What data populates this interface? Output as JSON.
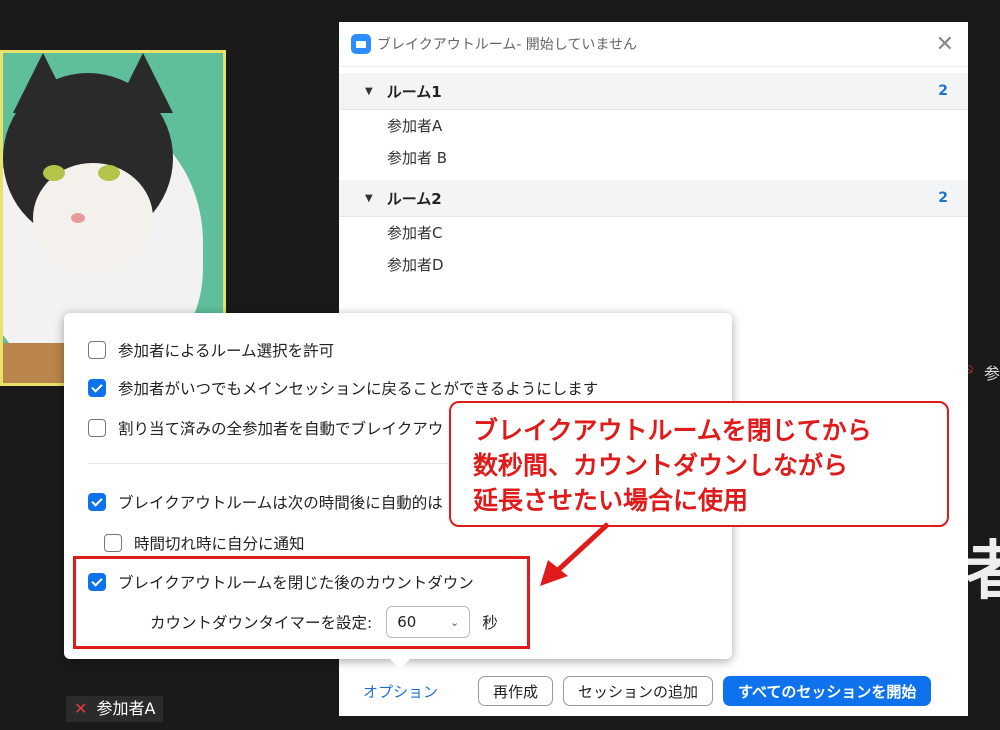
{
  "background": {
    "right_tile_label": "参",
    "right_big_text": "者",
    "bottom_participant_name": "参加者A"
  },
  "panel": {
    "title": "ブレイクアウトルーム- 開始していません",
    "rooms": [
      {
        "name": "ルーム1",
        "count": "2",
        "members": [
          "参加者A",
          "参加者 B"
        ]
      },
      {
        "name": "ルーム2",
        "count": "2",
        "members": [
          "参加者C",
          "参加者D"
        ]
      }
    ],
    "footer": {
      "options_label": "オプション",
      "recreate_label": "再作成",
      "add_session_label": "セッションの追加",
      "start_all_label": "すべてのセッションを開始"
    }
  },
  "options": {
    "allow_room_selection": {
      "label": "参加者によるルーム選択を許可",
      "checked": false
    },
    "return_anytime": {
      "label": "参加者がいつでもメインセッションに戻ることができるようにします",
      "checked": true
    },
    "auto_move": {
      "label": "割り当て済みの全参加者を自動でブレイクアウ",
      "checked": false
    },
    "auto_close": {
      "label": "ブレイクアウトルームは次の時間後に自動的は",
      "checked": true
    },
    "notify_on_timeout": {
      "label": "時間切れ時に自分に通知",
      "checked": false
    },
    "countdown": {
      "label": "ブレイクアウトルームを閉じた後のカウントダウン",
      "checked": true
    },
    "timer_label": "カウントダウンタイマーを設定:",
    "timer_value": "60",
    "timer_unit": "秒"
  },
  "callout": {
    "lines": [
      "ブレイクアウトルームを閉じてから",
      "数秒間、カウントダウンしながら",
      "延長させたい場合に使用"
    ]
  },
  "colors": {
    "accent": "#0e72ed",
    "highlight_red": "#e01b1b"
  }
}
